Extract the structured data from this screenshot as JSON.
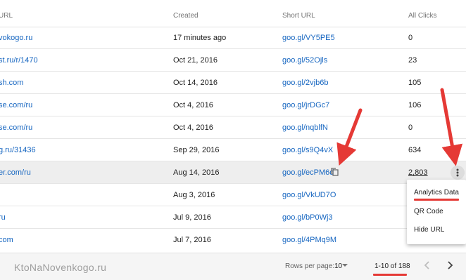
{
  "columns": {
    "url": "URL",
    "created": "Created",
    "short_url": "Short URL",
    "all_clicks": "All Clicks"
  },
  "rows": [
    {
      "url": "vokogo.ru",
      "created": "17 minutes ago",
      "short_url": "goo.gl/VY5PE5",
      "clicks": "0"
    },
    {
      "url": "st.ru/r/1470",
      "created": "Oct 21, 2016",
      "short_url": "goo.gl/52Ojls",
      "clicks": "23"
    },
    {
      "url": "sh.com",
      "created": "Oct 14, 2016",
      "short_url": "goo.gl/2vjb6b",
      "clicks": "105"
    },
    {
      "url": "se.com/ru",
      "created": "Oct 4, 2016",
      "short_url": "goo.gl/jrDGc7",
      "clicks": "106"
    },
    {
      "url": "se.com/ru",
      "created": "Oct 4, 2016",
      "short_url": "goo.gl/nqblfN",
      "clicks": "0"
    },
    {
      "url": "g.ru/31436",
      "created": "Sep 29, 2016",
      "short_url": "goo.gl/s9Q4vX",
      "clicks": "634"
    },
    {
      "url": "er.com/ru",
      "created": "Aug 14, 2016",
      "short_url": "goo.gl/ecPM6d",
      "clicks": "2,803"
    },
    {
      "url": "",
      "created": "Aug 3, 2016",
      "short_url": "goo.gl/VkUD7O",
      "clicks": ""
    },
    {
      "url": "ru",
      "created": "Jul 9, 2016",
      "short_url": "goo.gl/bP0Wj3",
      "clicks": ""
    },
    {
      "url": "com",
      "created": "Jul 7, 2016",
      "short_url": "goo.gl/4PMq9M",
      "clicks": ""
    }
  ],
  "menu": {
    "analytics": "Analytics Data",
    "qr": "QR Code",
    "hide": "Hide URL"
  },
  "footer": {
    "watermark": "KtoNaNovenkogo.ru",
    "rows_per_page_label": "Rows per page:",
    "rows_per_page_value": "10",
    "range": "1-10 of 188"
  },
  "colors": {
    "link": "#1565c0",
    "accent_red": "#e53935",
    "highlight_row": "#eeeeee"
  }
}
